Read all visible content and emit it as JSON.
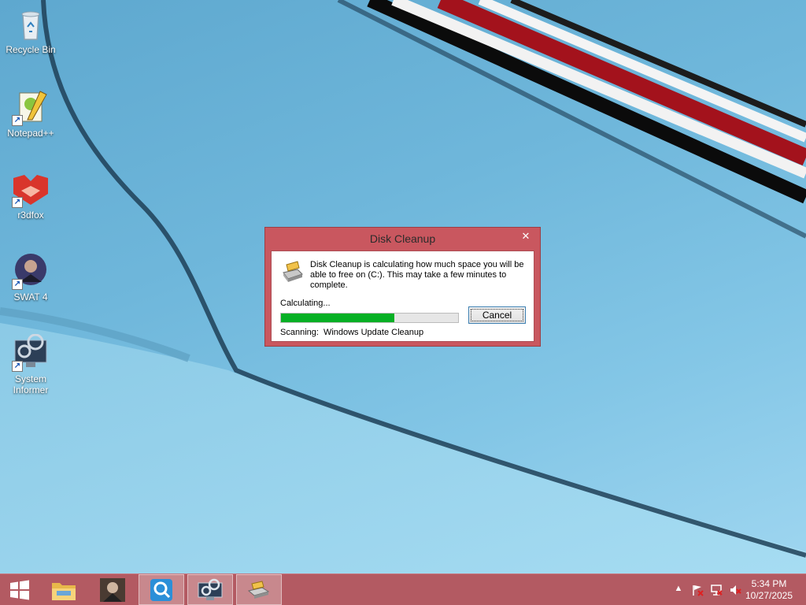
{
  "desktop": {
    "icons": [
      {
        "label": "Recycle Bin",
        "icon": "recycle-bin-icon",
        "shortcut": false
      },
      {
        "label": "Notepad++",
        "icon": "notepad-plus-plus-icon",
        "shortcut": true
      },
      {
        "label": "r3dfox",
        "icon": "r3dfox-icon",
        "shortcut": true
      },
      {
        "label": "SWAT 4",
        "icon": "swat4-icon",
        "shortcut": true
      },
      {
        "label": "System\nInformer",
        "icon": "system-informer-icon",
        "shortcut": true
      }
    ]
  },
  "dialog": {
    "title": "Disk Cleanup",
    "close_glyph": "✕",
    "message": "Disk Cleanup is calculating how much space you will be able to free on  (C:). This may take a few minutes to complete.",
    "status_label": "Calculating...",
    "progress_fraction": 0.64,
    "cancel_label": "Cancel",
    "scanning_label": "Scanning:",
    "scanning_item": "Windows Update Cleanup"
  },
  "taskbar": {
    "buttons": [
      {
        "name": "start-button",
        "icon": "windows-logo-icon"
      },
      {
        "name": "file-explorer-button",
        "icon": "folder-icon"
      },
      {
        "name": "swat4-taskbar-button",
        "icon": "swat4-icon"
      },
      {
        "name": "search-app-taskbar-button",
        "icon": "magnifier-icon"
      },
      {
        "name": "system-informer-taskbar-button",
        "icon": "system-informer-icon"
      },
      {
        "name": "disk-cleanup-taskbar-button",
        "icon": "disk-cleanup-icon"
      }
    ],
    "clock": {
      "time": "5:34 PM",
      "date": "10/27/2025"
    },
    "tray_icons": [
      "show-hidden-icons-icon",
      "action-center-flag-icon",
      "network-icon",
      "volume-muted-icon"
    ]
  },
  "colors": {
    "accent": "#b35a62",
    "dialog_frame": "#c9575f",
    "progress_fill": "#06b025"
  }
}
